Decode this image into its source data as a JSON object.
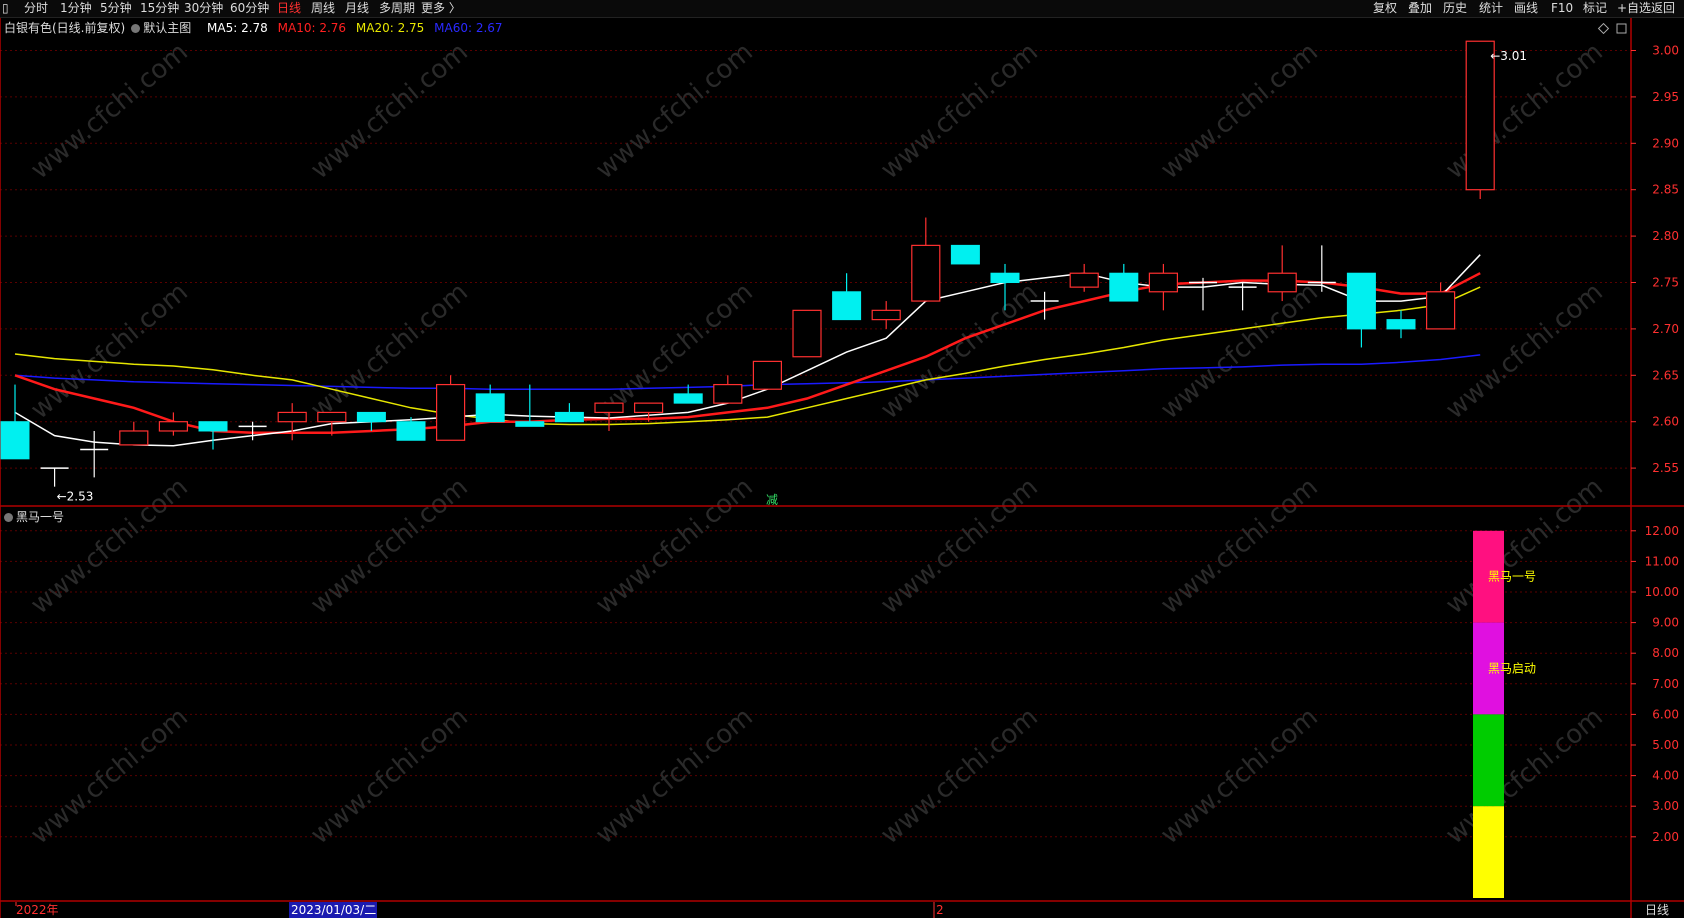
{
  "toolbar": {
    "left_icon": "window-icon",
    "periods": [
      "分时",
      "1分钟",
      "5分钟",
      "15分钟",
      "30分钟",
      "60分钟",
      "日线",
      "周线",
      "月线",
      "多周期",
      "更多 〉"
    ],
    "active_period": "日线",
    "right": [
      "复权",
      "叠加",
      "历史",
      "统计",
      "画线",
      "F10",
      "标记",
      "+自选",
      "返回"
    ]
  },
  "header": {
    "stock": "白银有色(日线.前复权)",
    "main_chart": "默认主图",
    "ma5": "MA5: 2.78",
    "ma10": "MA10: 2.76",
    "ma20": "MA20: 2.75",
    "ma60": "MA60: 2.67"
  },
  "colors": {
    "up": "#ff3030",
    "down": "#00f0f0",
    "ma5": "#ffffff",
    "ma10": "#ff1a1a",
    "ma20": "#e6e600",
    "ma60": "#1a1aff",
    "grid": "#5a0000",
    "axis": "#ff3030"
  },
  "price_axis": [
    "3.00",
    "2.95",
    "2.90",
    "2.85",
    "2.80",
    "2.75",
    "2.70",
    "2.65",
    "2.60",
    "2.55"
  ],
  "annotations": {
    "high": "3.01",
    "low": "2.53",
    "signal": "减"
  },
  "indicator": {
    "title": "黑马一号",
    "axis": [
      "12.00",
      "11.00",
      "10.00",
      "9.00",
      "8.00",
      "7.00",
      "6.00",
      "5.00",
      "4.00",
      "3.00",
      "2.00"
    ],
    "bars": [
      {
        "from": 9,
        "to": 12,
        "color": "#ff1080",
        "label": "黑马一号"
      },
      {
        "from": 6,
        "to": 9,
        "color": "#e010e0",
        "label": "黑马启动"
      },
      {
        "from": 3,
        "to": 6,
        "color": "#00cc00",
        "label": ""
      },
      {
        "from": 0,
        "to": 3,
        "color": "#ffff00",
        "label": ""
      }
    ]
  },
  "date_axis": {
    "year": "2022年",
    "cursor": "2023/01/03/二",
    "month": "2",
    "period": "日线"
  },
  "watermark": "www.cfchi.com",
  "chart_data": {
    "type": "candlestick",
    "ylim": [
      2.51,
      3.03
    ],
    "candles": [
      [
        2.6,
        2.64,
        2.56,
        2.56
      ],
      [
        2.55,
        2.55,
        2.53,
        2.55
      ],
      [
        2.57,
        2.59,
        2.54,
        2.57
      ],
      [
        2.575,
        2.6,
        2.575,
        2.59
      ],
      [
        2.59,
        2.61,
        2.585,
        2.6
      ],
      [
        2.6,
        2.6,
        2.57,
        2.59
      ],
      [
        2.595,
        2.6,
        2.58,
        2.595
      ],
      [
        2.6,
        2.62,
        2.58,
        2.61
      ],
      [
        2.6,
        2.61,
        2.585,
        2.61
      ],
      [
        2.61,
        2.61,
        2.59,
        2.6
      ],
      [
        2.6,
        2.605,
        2.58,
        2.58
      ],
      [
        2.58,
        2.65,
        2.58,
        2.64
      ],
      [
        2.63,
        2.64,
        2.6,
        2.6
      ],
      [
        2.6,
        2.64,
        2.595,
        2.595
      ],
      [
        2.61,
        2.62,
        2.6,
        2.6
      ],
      [
        2.61,
        2.62,
        2.59,
        2.62
      ],
      [
        2.61,
        2.62,
        2.6,
        2.62
      ],
      [
        2.63,
        2.64,
        2.62,
        2.62
      ],
      [
        2.62,
        2.65,
        2.62,
        2.64
      ],
      [
        2.635,
        2.665,
        2.635,
        2.665
      ],
      [
        2.67,
        2.72,
        2.67,
        2.72
      ],
      [
        2.74,
        2.76,
        2.71,
        2.71
      ],
      [
        2.71,
        2.73,
        2.7,
        2.72
      ],
      [
        2.73,
        2.82,
        2.73,
        2.79
      ],
      [
        2.79,
        2.79,
        2.77,
        2.77
      ],
      [
        2.76,
        2.77,
        2.72,
        2.75
      ],
      [
        2.73,
        2.74,
        2.71,
        2.73
      ],
      [
        2.745,
        2.77,
        2.74,
        2.76
      ],
      [
        2.76,
        2.77,
        2.73,
        2.73
      ],
      [
        2.74,
        2.77,
        2.72,
        2.76
      ],
      [
        2.75,
        2.755,
        2.72,
        2.75
      ],
      [
        2.745,
        2.75,
        2.72,
        2.745
      ],
      [
        2.74,
        2.79,
        2.73,
        2.76
      ],
      [
        2.75,
        2.79,
        2.74,
        2.75
      ],
      [
        2.76,
        2.76,
        2.68,
        2.7
      ],
      [
        2.71,
        2.72,
        2.69,
        2.7
      ],
      [
        2.7,
        2.75,
        2.7,
        2.74
      ],
      [
        2.85,
        3.01,
        2.84,
        3.01
      ]
    ],
    "ma5": [
      2.61,
      2.585,
      2.578,
      2.575,
      2.574,
      2.58,
      2.585,
      2.59,
      2.598,
      2.6,
      2.602,
      2.605,
      2.608,
      2.606,
      2.605,
      2.604,
      2.607,
      2.61,
      2.62,
      2.635,
      2.655,
      2.675,
      2.69,
      2.73,
      2.74,
      2.75,
      2.755,
      2.76,
      2.75,
      2.745,
      2.745,
      2.75,
      2.748,
      2.747,
      2.73,
      2.73,
      2.735,
      2.78
    ],
    "ma10": [
      2.65,
      2.635,
      2.625,
      2.615,
      2.6,
      2.59,
      2.588,
      2.588,
      2.588,
      2.59,
      2.592,
      2.595,
      2.6,
      2.6,
      2.602,
      2.603,
      2.603,
      2.605,
      2.61,
      2.615,
      2.625,
      2.64,
      2.655,
      2.67,
      2.69,
      2.705,
      2.72,
      2.73,
      2.74,
      2.748,
      2.75,
      2.752,
      2.752,
      2.75,
      2.745,
      2.738,
      2.738,
      2.76
    ],
    "ma20": [
      2.673,
      2.668,
      2.665,
      2.662,
      2.66,
      2.656,
      2.65,
      2.645,
      2.635,
      2.625,
      2.615,
      2.608,
      2.603,
      2.598,
      2.597,
      2.597,
      2.598,
      2.6,
      2.602,
      2.605,
      2.615,
      2.625,
      2.635,
      2.645,
      2.652,
      2.66,
      2.667,
      2.673,
      2.68,
      2.688,
      2.694,
      2.7,
      2.706,
      2.712,
      2.716,
      2.72,
      2.726,
      2.745
    ],
    "ma60": [
      2.65,
      2.647,
      2.645,
      2.643,
      2.642,
      2.641,
      2.64,
      2.639,
      2.638,
      2.637,
      2.636,
      2.636,
      2.635,
      2.635,
      2.635,
      2.635,
      2.636,
      2.637,
      2.638,
      2.64,
      2.641,
      2.642,
      2.643,
      2.645,
      2.647,
      2.649,
      2.651,
      2.653,
      2.655,
      2.657,
      2.658,
      2.659,
      2.661,
      2.662,
      2.662,
      2.664,
      2.667,
      2.672
    ]
  }
}
